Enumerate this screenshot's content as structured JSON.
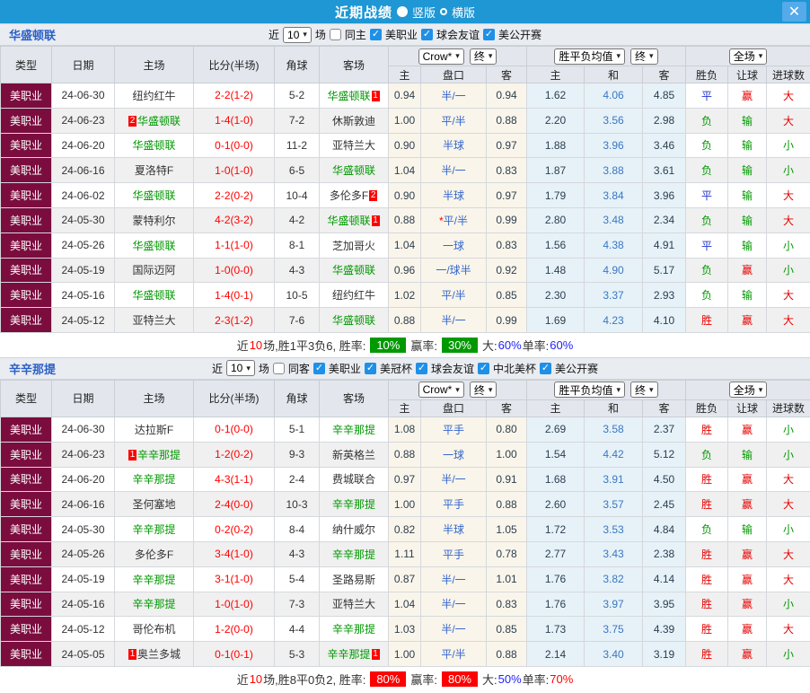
{
  "titlebar": {
    "title": "近期战绩",
    "vertical_label": "竖版",
    "horizontal_label": "横版",
    "close_icon": "✕"
  },
  "columns": {
    "type": "类型",
    "date": "日期",
    "home": "主场",
    "score": "比分(半场)",
    "corner": "角球",
    "away": "客场",
    "odds_home": "主",
    "handicap": "盘口",
    "odds_away": "客",
    "avg_home": "主",
    "avg_draw": "和",
    "avg_away": "客",
    "result": "胜负",
    "let_ball": "让球",
    "goals": "进球数"
  },
  "selects": {
    "company": "Crow*",
    "final": "终",
    "avg": "胜平负均值",
    "final2": "终",
    "scope": "全场"
  },
  "sections": [
    {
      "team": "华盛顿联",
      "filter": {
        "near": "近",
        "count": "10",
        "games": "场",
        "same_label": "同主",
        "same_checked": false,
        "leagues": [
          "美职业",
          "球会友谊",
          "美公开赛"
        ]
      },
      "rows": [
        {
          "type": "美职业",
          "date": "24-06-30",
          "home": {
            "name": "纽约红牛"
          },
          "score": "2-2(1-2)",
          "corner": "5-2",
          "away": {
            "name": "华盛顿联",
            "subject": true,
            "post": "1"
          },
          "h": "0.94",
          "hcap": "半/一",
          "a": "0.94",
          "avg": [
            "1.62",
            "4.06",
            "4.85"
          ],
          "res": "平",
          "let": "赢",
          "goal": "大"
        },
        {
          "type": "美职业",
          "date": "24-06-23",
          "home": {
            "name": "华盛顿联",
            "subject": true,
            "pre": "2"
          },
          "score": "1-4(1-0)",
          "corner": "7-2",
          "away": {
            "name": "休斯敦迪"
          },
          "h": "1.00",
          "hcap": "平/半",
          "a": "0.88",
          "avg": [
            "2.20",
            "3.56",
            "2.98"
          ],
          "res": "负",
          "let": "输",
          "goal": "大"
        },
        {
          "type": "美职业",
          "date": "24-06-20",
          "home": {
            "name": "华盛顿联",
            "subject": true
          },
          "score": "0-1(0-0)",
          "corner": "11-2",
          "away": {
            "name": "亚特兰大"
          },
          "h": "0.90",
          "hcap": "半球",
          "a": "0.97",
          "avg": [
            "1.88",
            "3.96",
            "3.46"
          ],
          "res": "负",
          "let": "输",
          "goal": "小"
        },
        {
          "type": "美职业",
          "date": "24-06-16",
          "home": {
            "name": "夏洛特F"
          },
          "score": "1-0(1-0)",
          "corner": "6-5",
          "away": {
            "name": "华盛顿联",
            "subject": true
          },
          "h": "1.04",
          "hcap": "半/一",
          "a": "0.83",
          "avg": [
            "1.87",
            "3.88",
            "3.61"
          ],
          "res": "负",
          "let": "输",
          "goal": "小"
        },
        {
          "type": "美职业",
          "date": "24-06-02",
          "home": {
            "name": "华盛顿联",
            "subject": true
          },
          "score": "2-2(0-2)",
          "corner": "10-4",
          "away": {
            "name": "多伦多F",
            "post": "2"
          },
          "h": "0.90",
          "hcap": "半球",
          "a": "0.97",
          "avg": [
            "1.79",
            "3.84",
            "3.96"
          ],
          "res": "平",
          "let": "输",
          "goal": "大"
        },
        {
          "type": "美职业",
          "date": "24-05-30",
          "home": {
            "name": "蒙特利尔"
          },
          "score": "4-2(3-2)",
          "corner": "4-2",
          "away": {
            "name": "华盛顿联",
            "subject": true,
            "post": "1"
          },
          "h": "0.88",
          "hcap": "平/半",
          "star": true,
          "a": "0.99",
          "avg": [
            "2.80",
            "3.48",
            "2.34"
          ],
          "res": "负",
          "let": "输",
          "goal": "大"
        },
        {
          "type": "美职业",
          "date": "24-05-26",
          "home": {
            "name": "华盛顿联",
            "subject": true
          },
          "score": "1-1(1-0)",
          "corner": "8-1",
          "away": {
            "name": "芝加哥火"
          },
          "h": "1.04",
          "hcap": "一球",
          "a": "0.83",
          "avg": [
            "1.56",
            "4.38",
            "4.91"
          ],
          "res": "平",
          "let": "输",
          "goal": "小"
        },
        {
          "type": "美职业",
          "date": "24-05-19",
          "home": {
            "name": "国际迈阿"
          },
          "score": "1-0(0-0)",
          "corner": "4-3",
          "away": {
            "name": "华盛顿联",
            "subject": true
          },
          "h": "0.96",
          "hcap": "一/球半",
          "a": "0.92",
          "avg": [
            "1.48",
            "4.90",
            "5.17"
          ],
          "res": "负",
          "let": "赢",
          "goal": "小"
        },
        {
          "type": "美职业",
          "date": "24-05-16",
          "home": {
            "name": "华盛顿联",
            "subject": true
          },
          "score": "1-4(0-1)",
          "corner": "10-5",
          "away": {
            "name": "纽约红牛"
          },
          "h": "1.02",
          "hcap": "平/半",
          "a": "0.85",
          "avg": [
            "2.30",
            "3.37",
            "2.93"
          ],
          "res": "负",
          "let": "输",
          "goal": "大"
        },
        {
          "type": "美职业",
          "date": "24-05-12",
          "home": {
            "name": "亚特兰大"
          },
          "score": "2-3(1-2)",
          "corner": "7-6",
          "away": {
            "name": "华盛顿联",
            "subject": true
          },
          "h": "0.88",
          "hcap": "半/一",
          "a": "0.99",
          "avg": [
            "1.69",
            "4.23",
            "4.10"
          ],
          "res": "胜",
          "let": "赢",
          "goal": "大"
        }
      ],
      "summary": [
        {
          "t": "近"
        },
        {
          "t": "10",
          "s": "red"
        },
        {
          "t": "场,胜1平3负6, 胜率:"
        },
        {
          "t": "10%",
          "s": "badge-green"
        },
        {
          "t": "赢率:"
        },
        {
          "t": "30%",
          "s": "badge-green"
        },
        {
          "t": "大:"
        },
        {
          "t": "60%",
          "s": "blue"
        },
        {
          "t": " 单率:"
        },
        {
          "t": "60%",
          "s": "blue"
        }
      ]
    },
    {
      "team": "辛辛那提",
      "filter": {
        "near": "近",
        "count": "10",
        "games": "场",
        "same_label": "同客",
        "same_checked": false,
        "leagues": [
          "美职业",
          "美冠杯",
          "球会友谊",
          "中北美杯",
          "美公开赛"
        ]
      },
      "rows": [
        {
          "type": "美职业",
          "date": "24-06-30",
          "home": {
            "name": "达拉斯F"
          },
          "score": "0-1(0-0)",
          "corner": "5-1",
          "away": {
            "name": "辛辛那提",
            "subject": true
          },
          "h": "1.08",
          "hcap": "平手",
          "a": "0.80",
          "avg": [
            "2.69",
            "3.58",
            "2.37"
          ],
          "res": "胜",
          "let": "赢",
          "goal": "小"
        },
        {
          "type": "美职业",
          "date": "24-06-23",
          "home": {
            "name": "辛辛那提",
            "subject": true,
            "pre": "1"
          },
          "score": "1-2(0-2)",
          "corner": "9-3",
          "away": {
            "name": "新英格兰"
          },
          "h": "0.88",
          "hcap": "一球",
          "a": "1.00",
          "avg": [
            "1.54",
            "4.42",
            "5.12"
          ],
          "res": "负",
          "let": "输",
          "goal": "小"
        },
        {
          "type": "美职业",
          "date": "24-06-20",
          "home": {
            "name": "辛辛那提",
            "subject": true
          },
          "score": "4-3(1-1)",
          "corner": "2-4",
          "away": {
            "name": "费城联合"
          },
          "h": "0.97",
          "hcap": "半/一",
          "a": "0.91",
          "avg": [
            "1.68",
            "3.91",
            "4.50"
          ],
          "res": "胜",
          "let": "赢",
          "goal": "大"
        },
        {
          "type": "美职业",
          "date": "24-06-16",
          "home": {
            "name": "圣何塞地"
          },
          "score": "2-4(0-0)",
          "corner": "10-3",
          "away": {
            "name": "辛辛那提",
            "subject": true
          },
          "h": "1.00",
          "hcap": "平手",
          "a": "0.88",
          "avg": [
            "2.60",
            "3.57",
            "2.45"
          ],
          "res": "胜",
          "let": "赢",
          "goal": "大"
        },
        {
          "type": "美职业",
          "date": "24-05-30",
          "home": {
            "name": "辛辛那提",
            "subject": true
          },
          "score": "0-2(0-2)",
          "corner": "8-4",
          "away": {
            "name": "纳什威尔"
          },
          "h": "0.82",
          "hcap": "半球",
          "a": "1.05",
          "avg": [
            "1.72",
            "3.53",
            "4.84"
          ],
          "res": "负",
          "let": "输",
          "goal": "小"
        },
        {
          "type": "美职业",
          "date": "24-05-26",
          "home": {
            "name": "多伦多F"
          },
          "score": "3-4(1-0)",
          "corner": "4-3",
          "away": {
            "name": "辛辛那提",
            "subject": true
          },
          "h": "1.11",
          "hcap": "平手",
          "a": "0.78",
          "avg": [
            "2.77",
            "3.43",
            "2.38"
          ],
          "res": "胜",
          "let": "赢",
          "goal": "大"
        },
        {
          "type": "美职业",
          "date": "24-05-19",
          "home": {
            "name": "辛辛那提",
            "subject": true
          },
          "score": "3-1(1-0)",
          "corner": "5-4",
          "away": {
            "name": "圣路易斯"
          },
          "h": "0.87",
          "hcap": "半/一",
          "a": "1.01",
          "avg": [
            "1.76",
            "3.82",
            "4.14"
          ],
          "res": "胜",
          "let": "赢",
          "goal": "大"
        },
        {
          "type": "美职业",
          "date": "24-05-16",
          "home": {
            "name": "辛辛那提",
            "subject": true
          },
          "score": "1-0(1-0)",
          "corner": "7-3",
          "away": {
            "name": "亚特兰大"
          },
          "h": "1.04",
          "hcap": "半/一",
          "a": "0.83",
          "avg": [
            "1.76",
            "3.97",
            "3.95"
          ],
          "res": "胜",
          "let": "赢",
          "goal": "小"
        },
        {
          "type": "美职业",
          "date": "24-05-12",
          "home": {
            "name": "哥伦布机"
          },
          "score": "1-2(0-0)",
          "corner": "4-4",
          "away": {
            "name": "辛辛那提",
            "subject": true
          },
          "h": "1.03",
          "hcap": "半/一",
          "a": "0.85",
          "avg": [
            "1.73",
            "3.75",
            "4.39"
          ],
          "res": "胜",
          "let": "赢",
          "goal": "大"
        },
        {
          "type": "美职业",
          "date": "24-05-05",
          "home": {
            "name": "奥兰多城",
            "pre": "1"
          },
          "score": "0-1(0-1)",
          "corner": "5-3",
          "away": {
            "name": "辛辛那提",
            "subject": true,
            "post": "1"
          },
          "h": "1.00",
          "hcap": "平/半",
          "a": "0.88",
          "avg": [
            "2.14",
            "3.40",
            "3.19"
          ],
          "res": "胜",
          "let": "赢",
          "goal": "小"
        }
      ],
      "summary": [
        {
          "t": "近"
        },
        {
          "t": "10",
          "s": "red"
        },
        {
          "t": "场,胜8平0负2, 胜率:"
        },
        {
          "t": "80%",
          "s": "badge-red"
        },
        {
          "t": "赢率:"
        },
        {
          "t": "80%",
          "s": "badge-red"
        },
        {
          "t": "大:"
        },
        {
          "t": "50%",
          "s": "blue"
        },
        {
          "t": " 单率:"
        },
        {
          "t": "70%",
          "s": "red"
        }
      ]
    }
  ]
}
